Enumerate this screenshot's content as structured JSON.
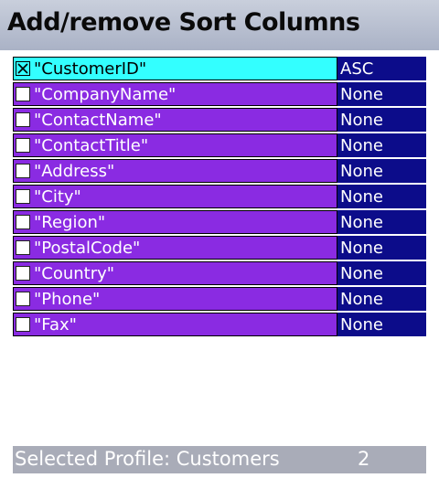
{
  "title": "Add/remove Sort Columns",
  "columns": [
    {
      "name": "\"CustomerID\"",
      "order": "ASC",
      "checked": true
    },
    {
      "name": "\"CompanyName\"",
      "order": "None",
      "checked": false
    },
    {
      "name": "\"ContactName\"",
      "order": "None",
      "checked": false
    },
    {
      "name": "\"ContactTitle\"",
      "order": "None",
      "checked": false
    },
    {
      "name": "\"Address\"",
      "order": "None",
      "checked": false
    },
    {
      "name": "\"City\"",
      "order": "None",
      "checked": false
    },
    {
      "name": "\"Region\"",
      "order": "None",
      "checked": false
    },
    {
      "name": "\"PostalCode\"",
      "order": "None",
      "checked": false
    },
    {
      "name": "\"Country\"",
      "order": "None",
      "checked": false
    },
    {
      "name": "\"Phone\"",
      "order": "None",
      "checked": false
    },
    {
      "name": "\"Fax\"",
      "order": "None",
      "checked": false
    }
  ],
  "status": {
    "label": "Selected Profile: Customers",
    "count": "2"
  },
  "colors": {
    "title_bg": "#b8bfd0",
    "row_bg": "#8a2be2",
    "row_selected_bg": "#33ffff",
    "order_bg": "#0c0c8a",
    "status_bg": "#a9acb8"
  },
  "icons": {
    "checked": "checkbox-checked-icon",
    "unchecked": "checkbox-unchecked-icon"
  }
}
